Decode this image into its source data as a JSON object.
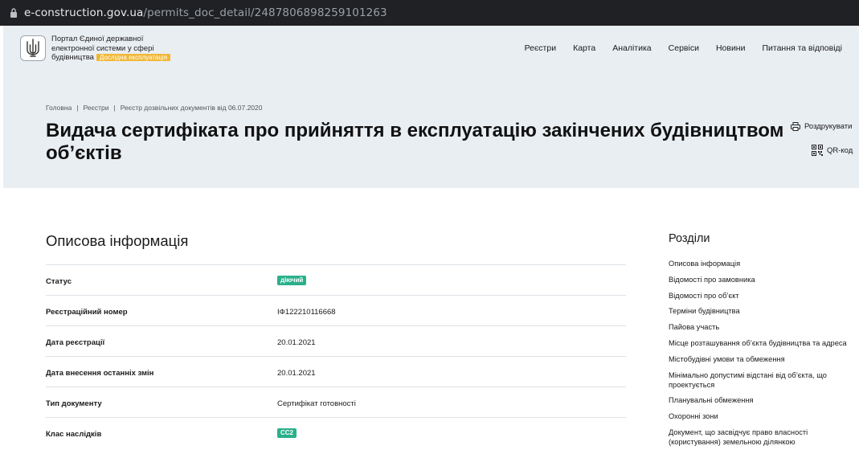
{
  "browser": {
    "url_host": "e-construction.gov.ua",
    "url_path": "/permits_doc_detail/2487806898259101263"
  },
  "header": {
    "logo_text": "Портал Єдиної державної електронної системи у сфері будівництва",
    "beta_badge": "Дослідна експлуатація",
    "nav": [
      "Реєстри",
      "Карта",
      "Аналітика",
      "Сервіси",
      "Новини",
      "Питання та відповіді"
    ]
  },
  "breadcrumbs": [
    "Головна",
    "Реєстри",
    "Реєстр дозвільних документів від 06.07.2020"
  ],
  "page_title": "Видача сертифіката про прийняття в експлуатацію закінчених будівництвом об’єктів",
  "actions": {
    "print": "Роздрукувати",
    "qr": "QR-код"
  },
  "section": {
    "title": "Описова інформація",
    "rows": [
      {
        "label": "Статус",
        "value": "діючий",
        "badge": true
      },
      {
        "label": "Реєстраційний номер",
        "value": "ІФ122210116668",
        "badge": false
      },
      {
        "label": "Дата реєстрації",
        "value": "20.01.2021",
        "badge": false
      },
      {
        "label": "Дата внесення останніх змін",
        "value": "20.01.2021",
        "badge": false
      },
      {
        "label": "Тип документу",
        "value": "Сертифікат готовності",
        "badge": false
      },
      {
        "label": "Клас наслідків",
        "value": "СС2",
        "badge": true
      }
    ]
  },
  "sidebar": {
    "title": "Розділи",
    "items": [
      "Описова інформація",
      "Відомості про замовника",
      "Відомості про об’єкт",
      "Терміни будівництва",
      "Пайова участь",
      "Місце розташування об’єкта будівництва та адреса",
      "Містобудівні умови та обмеження",
      "Мінімально допустимі відстані від об’єкта, що проектується",
      "Планувальні обмеження",
      "Охоронні зони",
      "Документ, що засвідчує право власності (користування) земельною ділянкою"
    ]
  },
  "colors": {
    "header_bg": "#e9eef3",
    "badge_green": "#2bb08b",
    "beta_yellow": "#f2b735"
  },
  "icons": [
    "lock-icon",
    "trident-logo",
    "printer-icon",
    "qr-code-icon"
  ]
}
